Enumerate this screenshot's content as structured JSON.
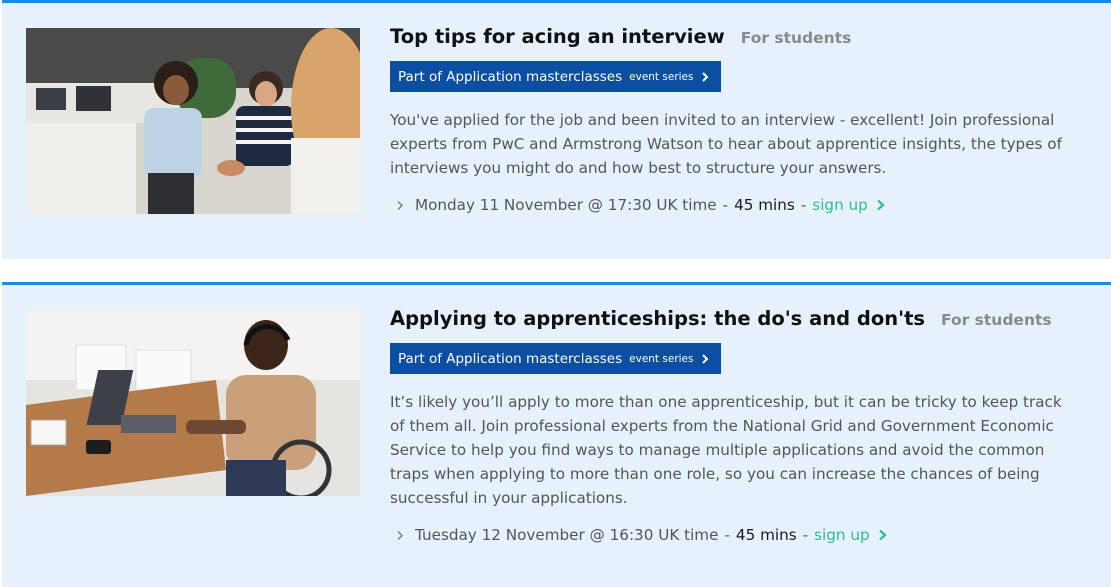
{
  "events": [
    {
      "title": "Top tips for acing an interview",
      "audience": "For students",
      "series": {
        "name": "Part of Application masterclasses",
        "suffix": "event series"
      },
      "description": "You've applied for the job and been invited to an interview - excellent! Join professional experts from PwC and Armstrong Watson to hear about apprentice insights, the types of interviews you might do and how best to structure your answers.",
      "datetime": "Monday 11 November @ 17:30 UK time",
      "separator": "-",
      "duration": "45 mins",
      "signup_label": "sign up",
      "image": "photo of people shaking hands in office"
    },
    {
      "title": "Applying to apprenticeships: the do's and don'ts",
      "audience": "For students",
      "series": {
        "name": "Part of Application masterclasses",
        "suffix": "event series"
      },
      "description": "It’s likely you’ll apply to more than one apprenticeship, but it can be tricky to keep track of them all. Join professional experts from the National Grid and Government Economic Service to help you find ways to manage multiple applications and avoid the common traps when applying to more than one role, so you can increase the chances of being successful in your applications.",
      "datetime": "Tuesday 12 November @ 16:30 UK time",
      "separator": "-",
      "duration": "45 mins",
      "signup_label": "sign up",
      "image": "photo of man in wheelchair using laptop"
    }
  ],
  "colors": {
    "card_bg": "#e7f1fc",
    "card_border": "#1e88e5",
    "badge_bg": "#0b4ea2",
    "signup": "#2bbf8a",
    "audience": "#8a8a8a"
  }
}
